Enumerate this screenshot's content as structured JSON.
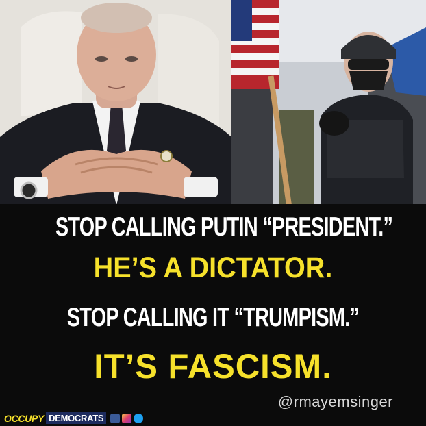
{
  "text": {
    "line1": "STOP CALLING PUTIN “PRESIDENT.”",
    "line2": "HE’S A DICTATOR.",
    "line3": "STOP CALLING IT “TRUMPISM.”",
    "line4": "IT’S FASCISM."
  },
  "handle": "@rmayemsinger",
  "footer": {
    "brand_part1": "OCCUPY",
    "brand_part2": "DEMOCRATS",
    "social_icons": [
      "facebook-icon",
      "instagram-icon",
      "twitter-icon"
    ]
  },
  "colors": {
    "highlight": "#f6e12b",
    "primary_text": "#ffffff",
    "background": "#0b0b0b",
    "brand_blue": "#1d2b5e"
  }
}
